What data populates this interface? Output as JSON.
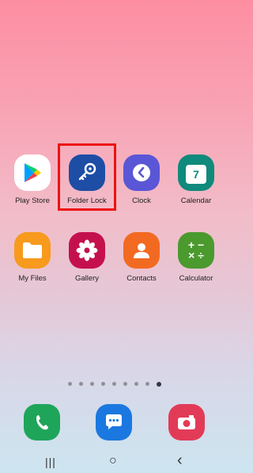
{
  "apps_row1": [
    {
      "label": "Play Store",
      "icon": "play-store-icon"
    },
    {
      "label": "Folder Lock",
      "icon": "key-icon"
    },
    {
      "label": "Clock",
      "icon": "clock-icon"
    },
    {
      "label": "Calendar",
      "icon": "calendar-icon",
      "day": "7"
    }
  ],
  "apps_row2": [
    {
      "label": "My Files",
      "icon": "folder-icon"
    },
    {
      "label": "Gallery",
      "icon": "flower-icon"
    },
    {
      "label": "Contacts",
      "icon": "person-icon"
    },
    {
      "label": "Calculator",
      "icon": "calculator-icon"
    }
  ],
  "calculator_symbols": "+ −\n× ÷",
  "page_indicator": {
    "count": 9,
    "active_index": 8
  },
  "dock": [
    {
      "name": "phone",
      "icon": "phone-icon",
      "color": "#1ea55a"
    },
    {
      "name": "messages",
      "icon": "message-icon",
      "color": "#1b78e0"
    },
    {
      "name": "camera",
      "icon": "camera-icon",
      "color": "#e23b57"
    }
  ],
  "navbar": {
    "recents": "|||",
    "home": "○",
    "back": "‹"
  }
}
